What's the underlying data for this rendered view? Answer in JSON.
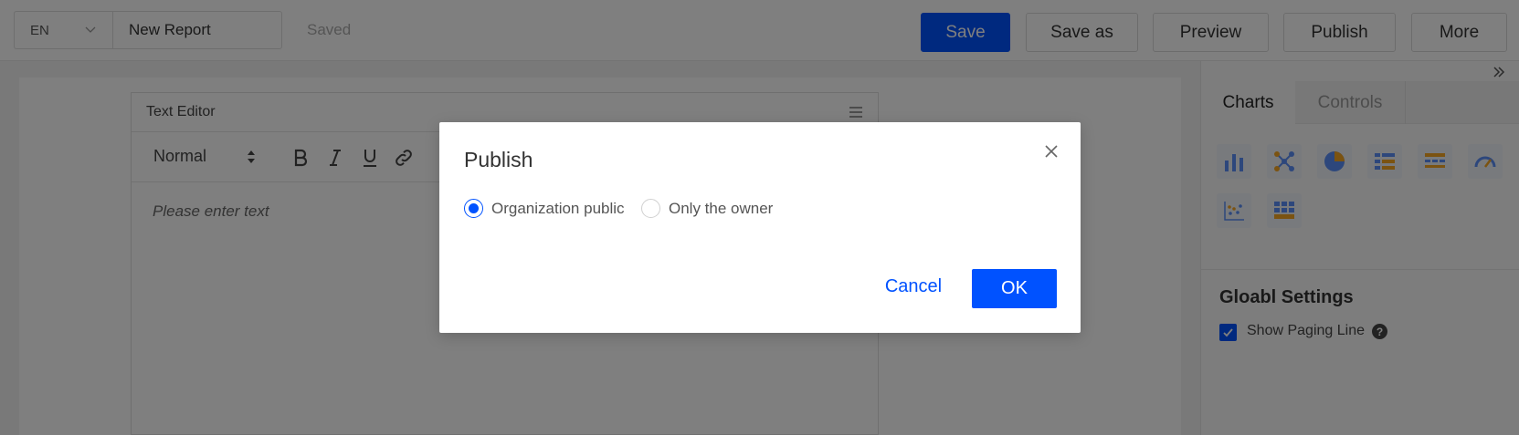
{
  "toolbar": {
    "language": "EN",
    "report_name": "New Report",
    "save_status": "Saved",
    "buttons": {
      "save": "Save",
      "save_as": "Save as",
      "preview": "Preview",
      "publish": "Publish",
      "more": "More"
    }
  },
  "editor": {
    "title": "Text Editor",
    "format": "Normal",
    "placeholder": "Please enter text",
    "tools": [
      "bold-icon",
      "italic-icon",
      "underline-icon",
      "link-icon"
    ]
  },
  "right_panel": {
    "tabs": [
      "Charts",
      "Controls"
    ],
    "active_tab": "Charts",
    "chart_icons": [
      "bar-chart-icon",
      "scatter-link-icon",
      "pie-chart-icon",
      "list-table-icon",
      "pivot-table-icon",
      "gauge-icon",
      "scatter-plot-icon",
      "grid-table-icon"
    ],
    "global_settings": {
      "title": "Gloabl Settings",
      "show_paging_line_label": "Show Paging Line",
      "show_paging_line": true
    }
  },
  "modal": {
    "title": "Publish",
    "options": [
      "Organization public",
      "Only the owner"
    ],
    "selected": "Organization public",
    "cancel_label": "Cancel",
    "ok_label": "OK"
  },
  "colors": {
    "primary": "#0052ff",
    "chart_blue": "#5b8ff9",
    "chart_orange": "#f6a623",
    "overlay": "rgba(0,0,0,0.5)"
  }
}
